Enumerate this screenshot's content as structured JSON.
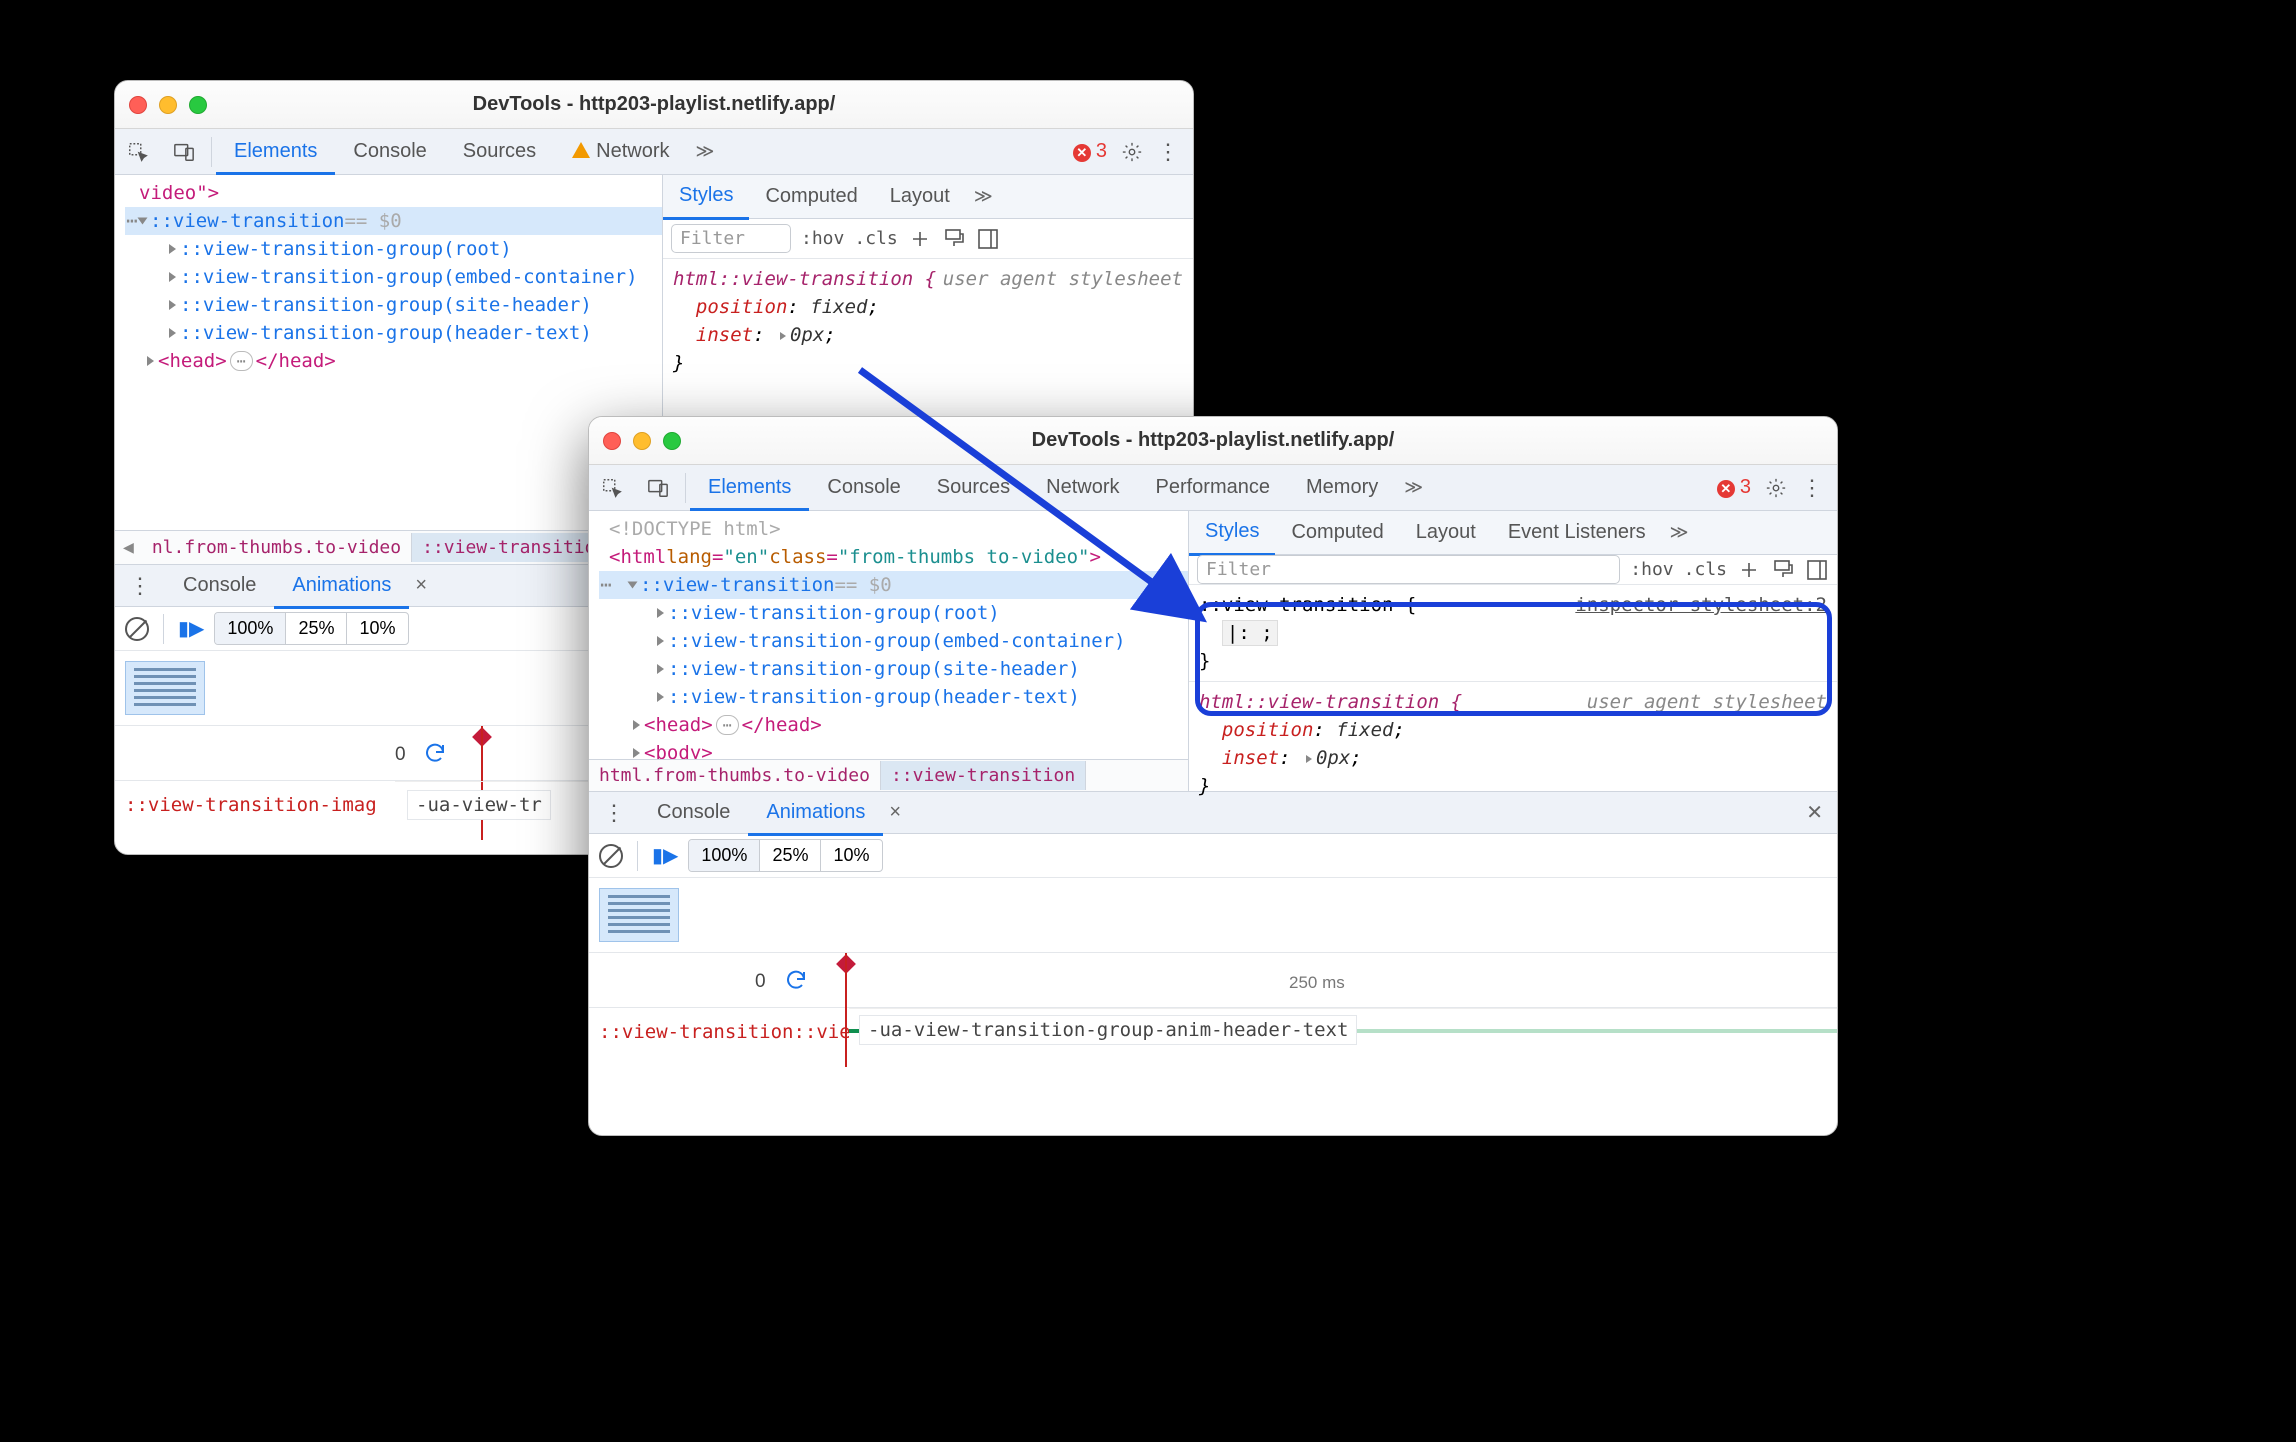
{
  "window1": {
    "title": "DevTools - http203-playlist.netlify.app/",
    "tabs": [
      "Elements",
      "Console",
      "Sources",
      "Network"
    ],
    "active_tab": 0,
    "error_count": "3",
    "dom": {
      "line0": "video\">",
      "sel": "::view-transition",
      "sel_suffix": " == $0",
      "groups": [
        "::view-transition-group(root)",
        "::view-transition-group(embed-container)",
        "::view-transition-group(site-header)",
        "::view-transition-group(header-text)"
      ],
      "head_open": "<head>",
      "head_close": "</head>"
    },
    "crumbs": {
      "c1": "nl.from-thumbs.to-video",
      "c2": "::view-transition"
    },
    "styles": {
      "tabs": [
        "Styles",
        "Computed",
        "Layout"
      ],
      "filter": "Filter",
      "hov": ":hov",
      "cls": ".cls",
      "rule_sel": "html::view-transition {",
      "src": "user agent stylesheet",
      "p1k": "position",
      "p1v": "fixed",
      "p2k": "inset",
      "p2v": "0px",
      "close": "}"
    },
    "drawer": {
      "tabs": [
        "Console",
        "Animations"
      ],
      "x": "×",
      "speeds": [
        "100%",
        "25%",
        "10%"
      ],
      "zero": "0",
      "anim_name": "::view-transition-imag",
      "anim_label": "-ua-view-tr"
    }
  },
  "window2": {
    "title": "DevTools - http203-playlist.netlify.app/",
    "tabs": [
      "Elements",
      "Console",
      "Sources",
      "Network",
      "Performance",
      "Memory"
    ],
    "active_tab": 0,
    "error_count": "3",
    "dom": {
      "line0": "<!DOCTYPE html>",
      "line1_a": "<html ",
      "line1_attr1": "lang",
      "line1_v1": "\"en\"",
      "line1_attr2": "class",
      "line1_v2": "\"from-thumbs to-video\"",
      "line1_b": ">",
      "sel": "::view-transition",
      "sel_suffix": " == $0",
      "groups": [
        "::view-transition-group(root)",
        "::view-transition-group(embed-container)",
        "::view-transition-group(site-header)",
        "::view-transition-group(header-text)"
      ],
      "head_open": "<head>",
      "head_close": "</head>",
      "body": "<body>"
    },
    "crumbs": {
      "c1": "html.from-thumbs.to-video",
      "c2": "::view-transition"
    },
    "styles": {
      "tabs": [
        "Styles",
        "Computed",
        "Layout",
        "Event Listeners"
      ],
      "filter": "Filter",
      "hov": ":hov",
      "cls": ".cls",
      "rule1_sel": "::view-transition {",
      "rule1_src": "inspector-stylesheet:2",
      "rule1_body": "|:  ;",
      "rule1_close": "}",
      "rule2_sel": "html::view-transition {",
      "rule2_src": "user agent stylesheet",
      "p1k": "position",
      "p1v": "fixed",
      "p2k": "inset",
      "p2v": "0px",
      "close": "}"
    },
    "drawer": {
      "tabs": [
        "Console",
        "Animations"
      ],
      "x": "×",
      "speeds": [
        "100%",
        "25%",
        "10%"
      ],
      "zero": "0",
      "t250": "250 ms",
      "anim_name": "::view-transition::vie",
      "anim_label": "-ua-view-transition-group-anim-header-text"
    }
  }
}
